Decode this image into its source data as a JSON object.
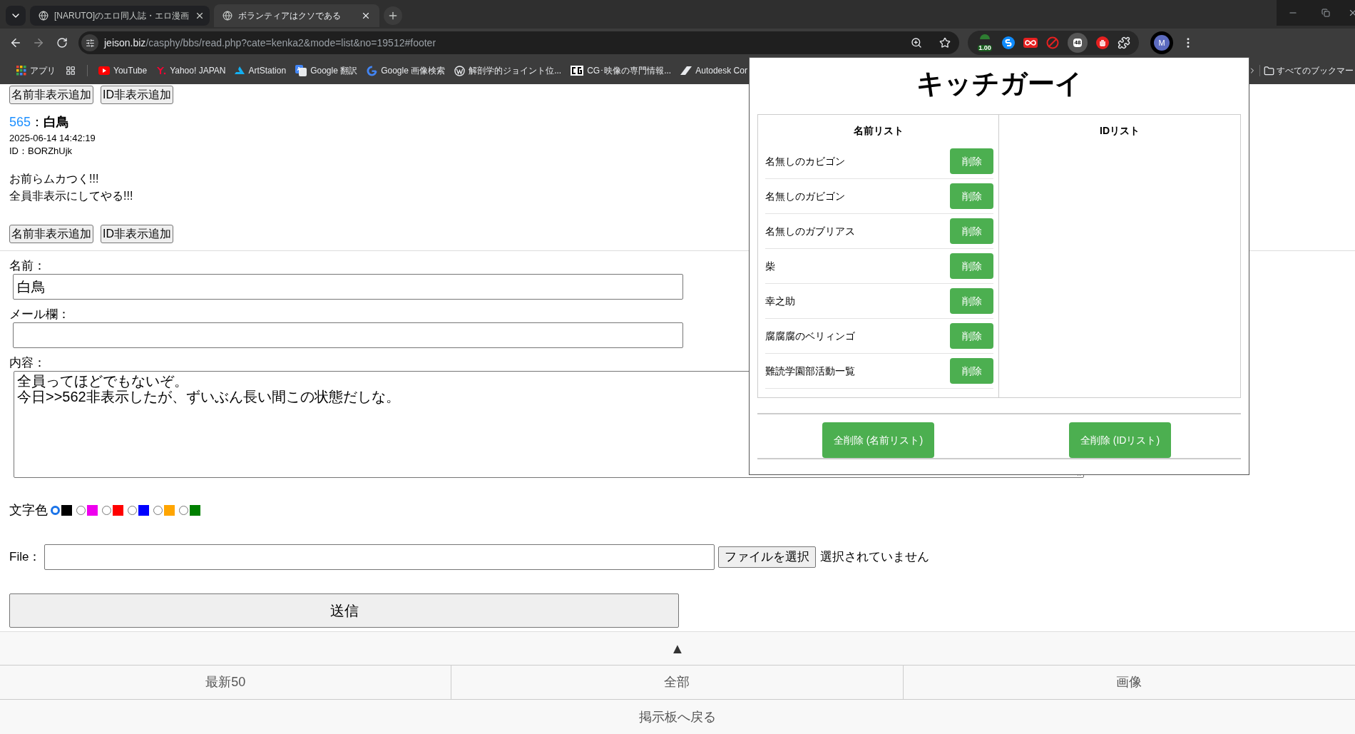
{
  "browser": {
    "tabs": [
      {
        "title": "[NARUTO]のエロ同人誌・エロ漫画",
        "selected": false
      },
      {
        "title": "ボランティアはクソである",
        "selected": true
      }
    ],
    "url": {
      "domain": "jeison.biz",
      "path": "/casphy/bbs/read.php?cate=kenka2&mode=list&no=19512#footer"
    },
    "extension_badge": "1.00",
    "extension_count": "48",
    "profile_initial": "M",
    "bookmarks": [
      {
        "label": "アプリ",
        "kind": "apps"
      },
      {
        "label": "YouTube",
        "kind": "youtube"
      },
      {
        "label": "Yahoo! JAPAN",
        "kind": "yahoo"
      },
      {
        "label": "ArtStation",
        "kind": "artstation"
      },
      {
        "label": "Google 翻訳",
        "kind": "translate"
      },
      {
        "label": "Google 画像検索",
        "kind": "google"
      },
      {
        "label": "解剖学的ジョイント位...",
        "kind": "wordpress"
      },
      {
        "label": "CG･映像の専門情報...",
        "kind": "cg"
      },
      {
        "label": "Autodesk Cor",
        "kind": "autodesk"
      }
    ],
    "all_bookmarks": "すべてのブックマー"
  },
  "post": {
    "top_buttons": [
      "名前非表示追加",
      "ID非表示追加"
    ],
    "number": "565",
    "separator": "：",
    "name": "白鳥",
    "date": "2025-06-14 14:42:19",
    "id": "ID：BORZhUjk",
    "body_lines": [
      "お前らムカつく!!!",
      "全員非表示にしてやる!!!"
    ],
    "buttons": [
      "名前非表示追加",
      "ID非表示追加"
    ]
  },
  "form": {
    "name_label": "名前：",
    "name_value": "白鳥",
    "mail_label": "メール欄：",
    "content_label": "内容：",
    "content_lines": [
      "全員ってほどでもないぞ。",
      "今日>>562非表示したが、ずいぶん長い間この状態だしな。"
    ],
    "color_label": "文字色",
    "colors": [
      {
        "color": "#000000",
        "selected": true
      },
      {
        "color": "#ee00ee",
        "selected": false
      },
      {
        "color": "#ff0000",
        "selected": false
      },
      {
        "color": "#0000ff",
        "selected": false
      },
      {
        "color": "#ffa500",
        "selected": false
      },
      {
        "color": "#008000",
        "selected": false
      }
    ],
    "file_label": "File：",
    "file_button": "ファイルを選択",
    "file_status": "選択されていません",
    "submit": "送信"
  },
  "footer": {
    "top": "▲",
    "nav": [
      "最新50",
      "全部",
      "画像"
    ],
    "back": "掲示板へ戻る"
  },
  "popup": {
    "title": "キッチガーイ",
    "name_list_title": "名前リスト",
    "id_list_title": "IDリスト",
    "names": [
      {
        "name": "名無しのカビゴン",
        "button": "削除"
      },
      {
        "name": "名無しのガビゴン",
        "button": "削除"
      },
      {
        "name": "名無しのガブリアス",
        "button": "削除"
      },
      {
        "name": "柴",
        "button": "削除"
      },
      {
        "name": "幸之助",
        "button": "削除"
      },
      {
        "name": "腐腐腐のベリィンゴ",
        "button": "削除"
      },
      {
        "name": "難読学園部活動一覧",
        "button": "削除"
      }
    ],
    "clear_buttons": [
      "全削除 (名前リスト)",
      "全削除 (IDリスト)"
    ]
  }
}
